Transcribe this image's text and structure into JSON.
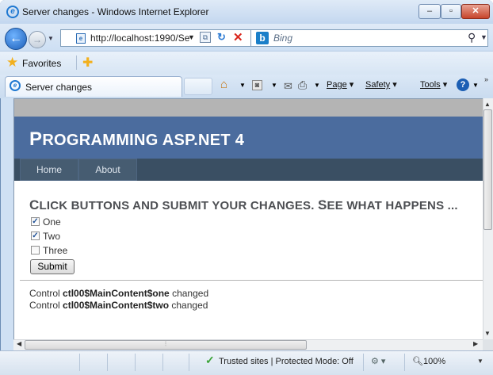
{
  "window": {
    "title": "Server changes - Windows Internet Explorer",
    "minimize_label": "–",
    "maximize_label": "▫",
    "close_label": "✕"
  },
  "address": {
    "url": "http://localhost:1990/Se",
    "search_placeholder": "Bing",
    "bing_logo": "b"
  },
  "favorites": {
    "label": "Favorites"
  },
  "tab": {
    "title": "Server changes"
  },
  "command_bar": {
    "page_label": "Page",
    "safety_label": "Safety",
    "tools_label": "Tools"
  },
  "site": {
    "title_first": "P",
    "title_rest": "ROGRAMMING ASP.NET 4",
    "nav": [
      {
        "label": "Home"
      },
      {
        "label": "About"
      }
    ]
  },
  "main": {
    "heading_parts": [
      "C",
      "LICK BUTTONS AND SUBMIT YOUR CHANGES. ",
      "S",
      "EE WHAT HAPPENS ..."
    ],
    "checkboxes": [
      {
        "label": "One",
        "checked": true
      },
      {
        "label": "Two",
        "checked": true
      },
      {
        "label": "Three",
        "checked": false
      }
    ],
    "submit_label": "Submit",
    "log": [
      {
        "prefix": "Control ",
        "control": "ctl00$MainContent$one",
        "suffix": " changed"
      },
      {
        "prefix": "Control ",
        "control": "ctl00$MainContent$two",
        "suffix": " changed"
      }
    ]
  },
  "status": {
    "zone": "Trusted sites | Protected Mode: Off",
    "zoom": "100%"
  },
  "icons": {
    "ie_logo": "ie-logo-icon",
    "back": "back-arrow-icon",
    "forward": "forward-arrow-icon",
    "refresh": "refresh-icon",
    "stop": "stop-icon",
    "search": "search-icon",
    "favorites": "favorites-star-icon",
    "home": "home-icon",
    "feeds": "feeds-icon",
    "mail": "mail-icon",
    "print": "print-icon",
    "help": "help-icon"
  },
  "colors": {
    "header_bg": "#4b6c9e",
    "menu_bg": "#465c71",
    "heading_text": "#4d4f53"
  }
}
